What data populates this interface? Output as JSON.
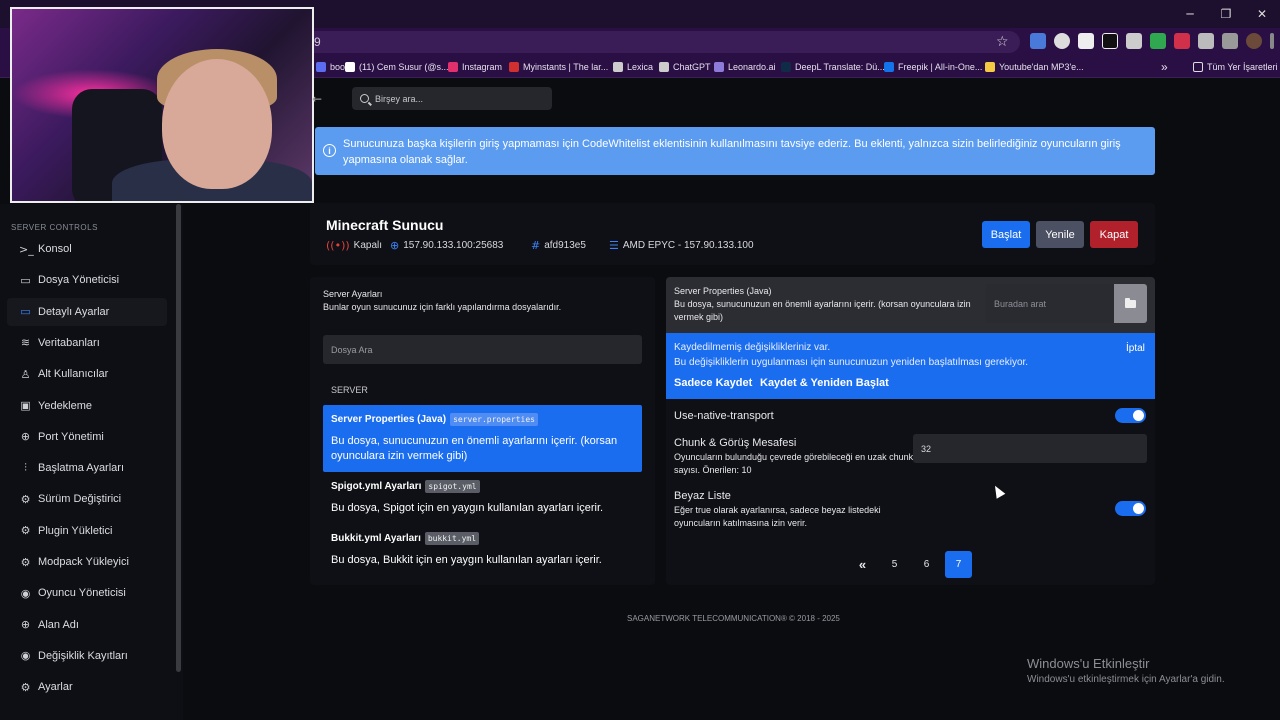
{
  "browser": {
    "url_fragment": "9",
    "bookmarks": [
      {
        "label": "book",
        "color": "#5b6cf0"
      },
      {
        "label": "(11) Cem Susur (@s...",
        "color": "#ffffff"
      },
      {
        "label": "Instagram",
        "color": "#e1306c"
      },
      {
        "label": "Myinstants | The lar...",
        "color": "#d03030"
      },
      {
        "label": "Lexica",
        "color": "#cccccc"
      },
      {
        "label": "ChatGPT",
        "color": "#cccccc"
      },
      {
        "label": "Leonardo.ai",
        "color": "#8d7bd9"
      },
      {
        "label": "DeepL Translate: Dü...",
        "color": "#0f2b46"
      },
      {
        "label": "Freepik | All-in-One...",
        "color": "#1273eb"
      },
      {
        "label": "Youtube'dan MP3'e...",
        "color": "#f6c945"
      }
    ],
    "more_bookmarks": "»",
    "all_bookmarks": "Tüm Yer İşaretleri"
  },
  "sidebar": {
    "heading": "SERVER CONTROLS",
    "items": [
      {
        "label": "Konsol",
        "icon": ">_"
      },
      {
        "label": "Dosya Yöneticisi",
        "icon": "▭"
      },
      {
        "label": "Detaylı Ayarlar",
        "icon": "▭"
      },
      {
        "label": "Veritabanları",
        "icon": "≋"
      },
      {
        "label": "Alt Kullanıcılar",
        "icon": "♙"
      },
      {
        "label": "Yedekleme",
        "icon": "▣"
      },
      {
        "label": "Port Yönetimi",
        "icon": "⊕"
      },
      {
        "label": "Başlatma Ayarları",
        "icon": "⫶"
      },
      {
        "label": "Sürüm Değiştirici",
        "icon": "⚙"
      },
      {
        "label": "Plugin Yükletici",
        "icon": "⚙"
      },
      {
        "label": "Modpack Yükleyici",
        "icon": "⚙"
      },
      {
        "label": "Oyuncu Yöneticisi",
        "icon": "◉"
      },
      {
        "label": "Alan Adı",
        "icon": "⊕"
      },
      {
        "label": "Değişiklik Kayıtları",
        "icon": "◉"
      },
      {
        "label": "Ayarlar",
        "icon": "⚙"
      }
    ]
  },
  "search": {
    "placeholder": "Birşey ara..."
  },
  "alert": {
    "text": "Sunucunuza başka kişilerin giriş yapmaması için CodeWhitelist eklentisinin kullanılmasını tavsiye ederiz. Bu eklenti, yalnızca sizin belirlediğiniz oyuncuların giriş yapmasına olanak sağlar."
  },
  "server": {
    "title": "Minecraft Sunucu",
    "status": "Kapalı",
    "address": "157.90.133.100:25683",
    "id": "afd913e5",
    "node": "AMD EPYC - 157.90.133.100",
    "buttons": {
      "start": "Başlat",
      "restart": "Yenile",
      "stop": "Kapat"
    }
  },
  "config_panel": {
    "title": "Server Ayarları",
    "subtitle": "Bunlar oyun sunucunuz için farklı yapılandırma dosyalarıdır.",
    "search_placeholder": "Dosya Ara",
    "section": "SERVER",
    "files": [
      {
        "name": "Server Properties (Java)",
        "tag": "server.properties",
        "desc": "Bu dosya, sunucunuzun en önemli ayarlarını içerir. (korsan oyunculara izin vermek gibi)"
      },
      {
        "name": "Spigot.yml Ayarları",
        "tag": "spigot.yml",
        "desc": "Bu dosya, Spigot için en yaygın kullanılan ayarları içerir."
      },
      {
        "name": "Bukkit.yml Ayarları",
        "tag": "bukkit.yml",
        "desc": "Bu dosya, Bukkit için en yaygın kullanılan ayarları içerir."
      }
    ]
  },
  "editor": {
    "title": "Server Properties (Java)",
    "desc": "Bu dosya, sunucunuzun en önemli ayarlarını içerir. (korsan oyunculara izin vermek gibi)",
    "search_placeholder": "Buradan arat",
    "unsaved": {
      "line1": "Kaydedilmemiş değişiklikleriniz var.",
      "line2": "Bu değişikliklerin uygulanması için sunucunuzun yeniden başlatılması gerekiyor.",
      "cancel": "İptal",
      "save": "Sadece Kaydet",
      "save_restart": "Kaydet & Yeniden Başlat"
    },
    "settings": {
      "native_transport": {
        "label": "Use-native-transport",
        "enabled": true
      },
      "view_distance": {
        "label": "Chunk & Görüş Mesafesi",
        "desc": "Oyuncuların bulunduğu çevrede görebileceği en uzak chunk sayısı. Önerilen: 10",
        "value": "32"
      },
      "whitelist": {
        "label": "Beyaz Liste",
        "desc": "Eğer true olarak ayarlanırsa, sadece beyaz listedeki oyuncuların katılmasına izin verir.",
        "enabled": true
      }
    },
    "pagination": {
      "prev": "«",
      "pages": [
        "5",
        "6",
        "7"
      ],
      "current": "7"
    }
  },
  "footer": "SAGANETWORK TELECOMMUNICATION® © 2018 - 2025",
  "activation": {
    "title": "Windows'u Etkinleştir",
    "subtitle": "Windows'u etkinleştirmek için Ayarlar'a gidin."
  }
}
